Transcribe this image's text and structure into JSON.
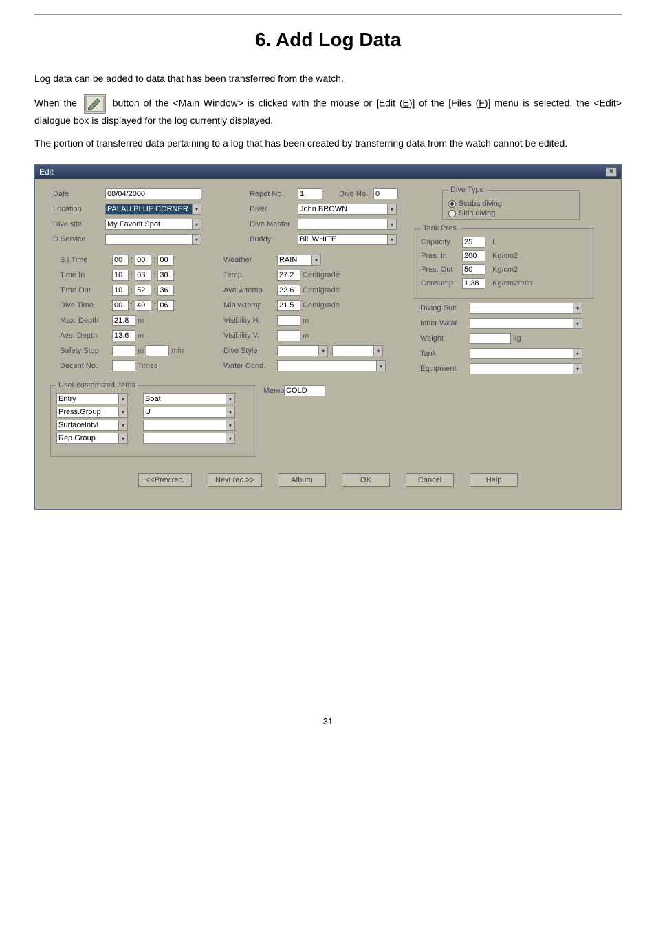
{
  "title": "6. Add Log Data",
  "intro": {
    "p1": "Log data can be added to data that has been transferred from the watch.",
    "p2a": "When the ",
    "p2b": " button of the <Main Window> is clicked with the mouse or [Edit (",
    "p2u1": "E",
    "p2c": ")] of the [Files (",
    "p2u2": "F",
    "p2d": ")] menu is selected, the <Edit> dialogue box is displayed for the log currently displayed.",
    "p3": "The portion of transferred data pertaining to a log that has been created by transferring data from the watch cannot be edited."
  },
  "dialog": {
    "title": "Edit",
    "labels": {
      "date": "Date",
      "location": "Location",
      "divesite": "Dive site",
      "dservice": "D.Service",
      "sitime": "S.I.Time",
      "timein": "Time In",
      "timeout": "Time Out",
      "divetime": "Dive Time",
      "maxdepth": "Max. Depth",
      "avedepth": "Ave. Depth",
      "safetystop": "Safety Stop",
      "decentno": "Decent No.",
      "repetno": "Repet No.",
      "diveno": "Dive No.",
      "diver": "Diver",
      "divemaster": "Dive Master",
      "buddy": "Buddy",
      "weather": "Weather",
      "temp": "Temp.",
      "avewtemp": "Ave.w.temp",
      "minwtemp": "Min.w.temp",
      "visH": "Visibility H.",
      "visV": "Visibility V.",
      "divestyle": "Dive Style",
      "watercond": "Water Cond.",
      "divetype": "Dive Type",
      "scuba": "Scuba diving",
      "skin": "Skin diving",
      "tankpres": "Tank Pres.",
      "capacity": "Capacity",
      "presin": "Pres. In",
      "presout": "Pres. Out",
      "consump": "Consump.",
      "divingsuit": "Diving Suit",
      "innerwear": "Inner Wear",
      "weight": "Weight",
      "tank": "Tank",
      "equipment": "Equipment",
      "useritems": "User customized Items",
      "memo": "Memo"
    },
    "values": {
      "date": "08/04/2000",
      "location": "PALAU BLUE CORNER",
      "divesite": "My Favorit Spot",
      "sitime": [
        "00",
        "00",
        "00"
      ],
      "timein": [
        "10",
        "03",
        "30"
      ],
      "timeout": [
        "10",
        "52",
        "36"
      ],
      "divetime": [
        "00",
        "49",
        "06"
      ],
      "maxdepth": "21.8",
      "avedepth": "13.6",
      "safetystop_m": "",
      "times": "Times",
      "repetno": "1",
      "diveno": "0",
      "diver": "John BROWN",
      "buddy": "Bill WHITE",
      "weather": "RAIN",
      "temp": "27.2",
      "avewtemp": "22.6",
      "minwtemp": "21.5",
      "capacity": "25",
      "presin": "200",
      "presout": "50",
      "consump": "1.38",
      "memo": "COLD",
      "entry": "Entry",
      "entry_v": "Boat",
      "pressgroup": "Press.Group",
      "pressgroup_v": "U",
      "surfaceintvl": "SurfaceIntvl",
      "repgroup": "Rep.Group"
    },
    "units": {
      "m": "m",
      "min": "min",
      "centigrade": "Centigrade",
      "L": "L",
      "kgcm2": "Kg/cm2",
      "kgcm2min": "Kg/cm2/min",
      "kg": "kg"
    },
    "buttons": {
      "prev": "<<Prev.rec.",
      "next": "Next rec.>>",
      "album": "Album",
      "ok": "OK",
      "cancel": "Cancel",
      "help": "Help"
    }
  },
  "pagenum": "31"
}
